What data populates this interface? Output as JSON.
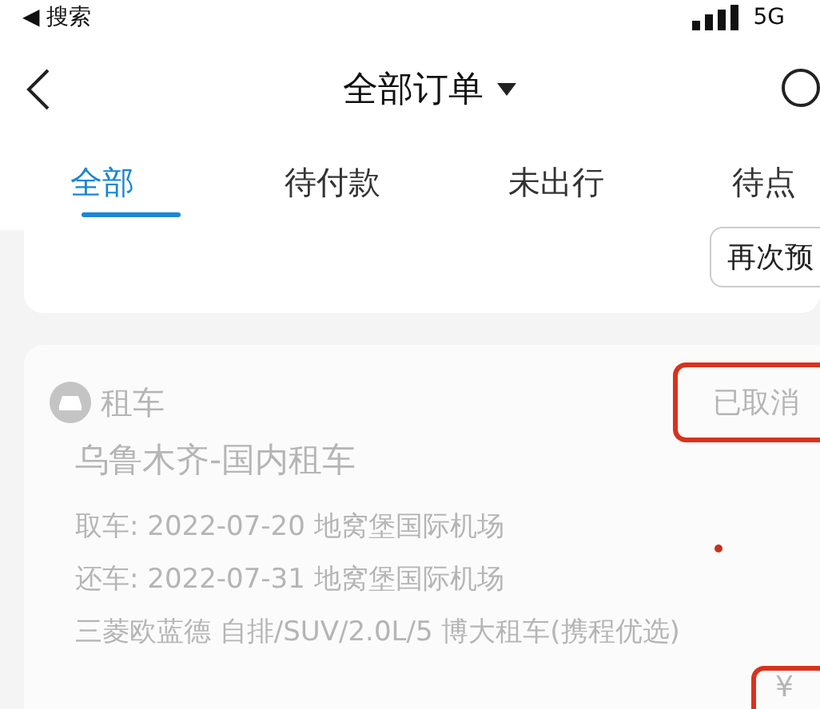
{
  "status_bar": {
    "back_label": "◀ 搜索",
    "network": "5G"
  },
  "nav": {
    "title": "全部订单"
  },
  "tabs": [
    {
      "label": "全部",
      "selected": true
    },
    {
      "label": "待付款",
      "selected": false
    },
    {
      "label": "未出行",
      "selected": false
    },
    {
      "label": "待点",
      "selected": false
    }
  ],
  "previous_order": {
    "button": "再次预"
  },
  "order": {
    "category": "租车",
    "status": "已取消",
    "status_highlighted": true,
    "title": "乌鲁木齐-国内租车",
    "lines": [
      "取车: 2022-07-20 地窝堡国际机场",
      "还车: 2022-07-31 地窝堡国际机场",
      "三菱欧蓝德 自排/SUV/2.0L/5 博大租车(携程优选)"
    ],
    "price": "¥",
    "price_highlighted": true
  }
}
